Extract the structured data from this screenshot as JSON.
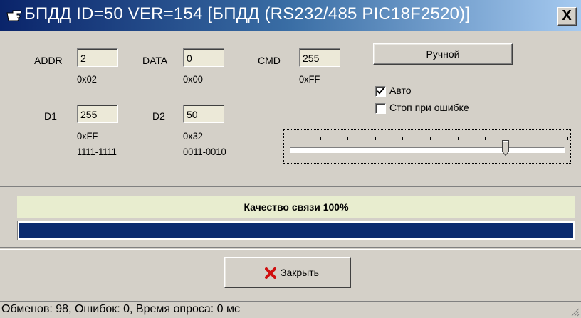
{
  "window": {
    "title": "БПДД ID=50 VER=154 [БПДД (RS232/485 PIC18F2520)]",
    "close_glyph": "X",
    "icon": "pointing-hand-icon"
  },
  "fields": {
    "addr": {
      "label": "ADDR",
      "value": "2",
      "hex": "0x02"
    },
    "data": {
      "label": "DATA",
      "value": "0",
      "hex": "0x00"
    },
    "cmd": {
      "label": "CMD",
      "value": "255",
      "hex": "0xFF"
    },
    "d1": {
      "label": "D1",
      "value": "255",
      "hex": "0xFF",
      "bin": "1111-1111"
    },
    "d2": {
      "label": "D2",
      "value": "50",
      "hex": "0x32",
      "bin": "0011-0010"
    }
  },
  "manual_button": "Ручной",
  "checkboxes": {
    "auto": {
      "label": "Авто",
      "checked": true
    },
    "stop_on_error": {
      "label": "Стоп при ошибке",
      "checked": false
    }
  },
  "slider": {
    "position_fraction": 0.785
  },
  "quality": {
    "label": "Качество связи  100%",
    "progress_fraction": 1.0
  },
  "close_button": {
    "label": "Закрыть",
    "icon": "red-x-icon"
  },
  "status": "Обменов: 98, Ошибок: 0, Время опроса: 0 мс",
  "colors": {
    "title_start": "#0a246a",
    "progress_fill": "#0a2a6e",
    "quality_bg": "#e8edcf"
  }
}
